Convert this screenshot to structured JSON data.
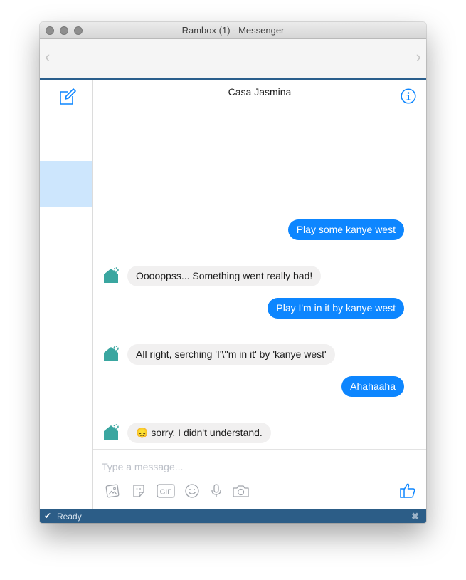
{
  "window": {
    "title": "Rambox (1) - Messenger"
  },
  "nav": {
    "back_icon": "chevron-left-icon",
    "forward_icon": "chevron-right-icon"
  },
  "sidebar": {
    "compose_icon": "compose-icon"
  },
  "chat": {
    "title": "Casa Jasmina",
    "info_icon": "info-icon",
    "messages": [
      {
        "direction": "out",
        "text": "Play some kanye west"
      },
      {
        "direction": "in",
        "text": "Ooooppss... Something went really bad!"
      },
      {
        "direction": "out",
        "text": "Play I'm in it by kanye west"
      },
      {
        "direction": "in",
        "text": "All right, serching 'I'\\''m in it' by 'kanye west'"
      },
      {
        "direction": "out",
        "text": "Ahahaaha"
      },
      {
        "direction": "in",
        "text": "sorry, I didn't understand.",
        "emoji": "😞"
      }
    ]
  },
  "composer": {
    "placeholder": "Type a message...",
    "tools": [
      "photo-icon",
      "sticker-icon",
      "gif-icon",
      "emoji-icon",
      "microphone-icon",
      "camera-icon"
    ],
    "gif_label": "GIF",
    "like_icon": "thumbs-up-icon"
  },
  "statusbar": {
    "text": "Ready",
    "check_icon": "checkmark-icon",
    "close_icon": "close-icon"
  },
  "colors": {
    "accent": "#0d86ff",
    "statusbar": "#2c5d87",
    "incoming_bubble": "#f1f0f0",
    "bot_avatar": "#3aa6a0"
  }
}
